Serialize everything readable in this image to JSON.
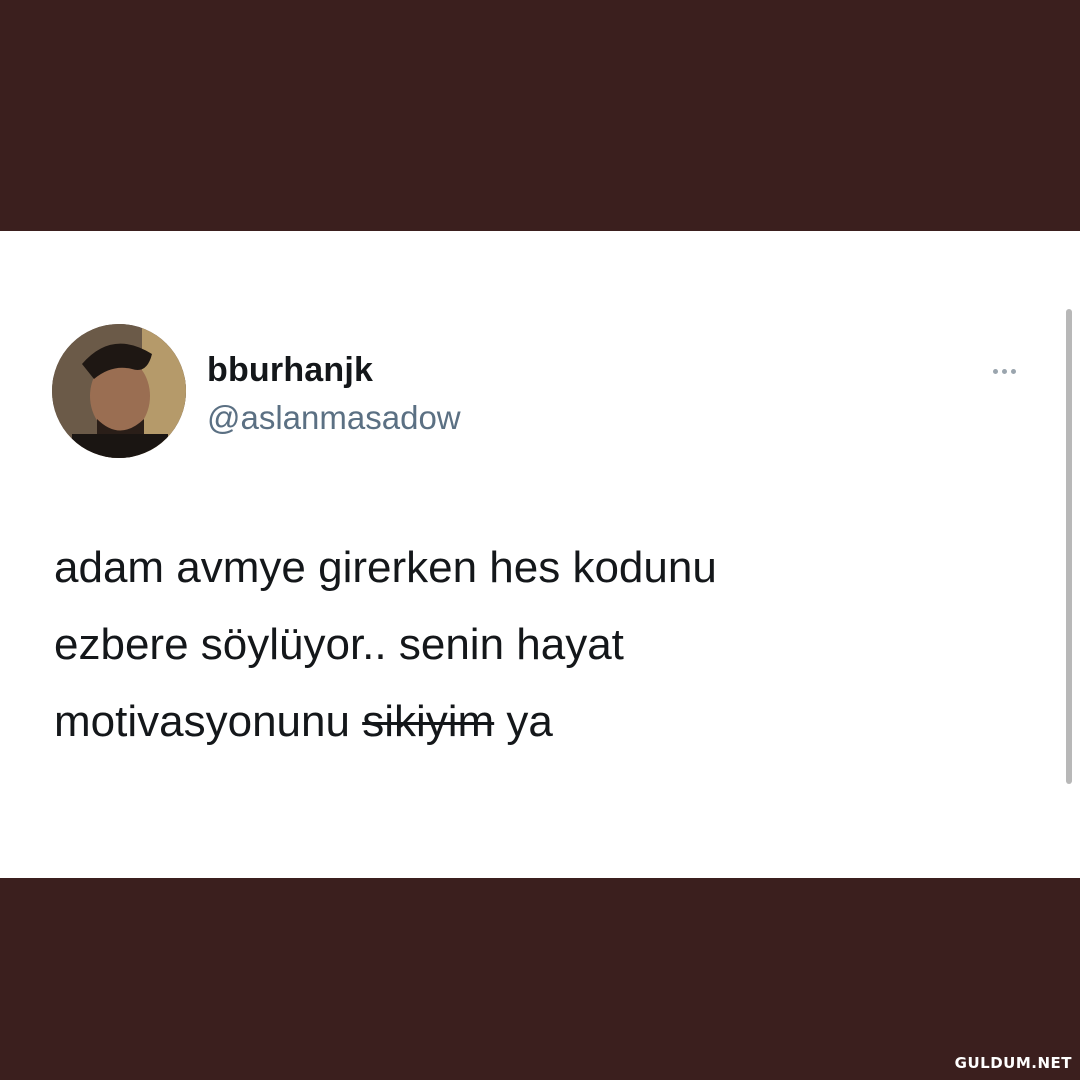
{
  "tweet": {
    "display_name": "bburhanjk",
    "handle": "@aslanmasadow",
    "text_lines": [
      "adam avmye girerken hes kodunu",
      "ezbere söylüyor.. senin hayat",
      "motivasyonunu"
    ],
    "struck_word": "sikiyim",
    "text_tail": "ya",
    "more_icon": "ellipsis-icon"
  },
  "watermark": "GULDUM.NET",
  "colors": {
    "background": "#3b1f1e",
    "card": "#ffffff",
    "text": "#14171a",
    "handle": "#5b7083"
  }
}
